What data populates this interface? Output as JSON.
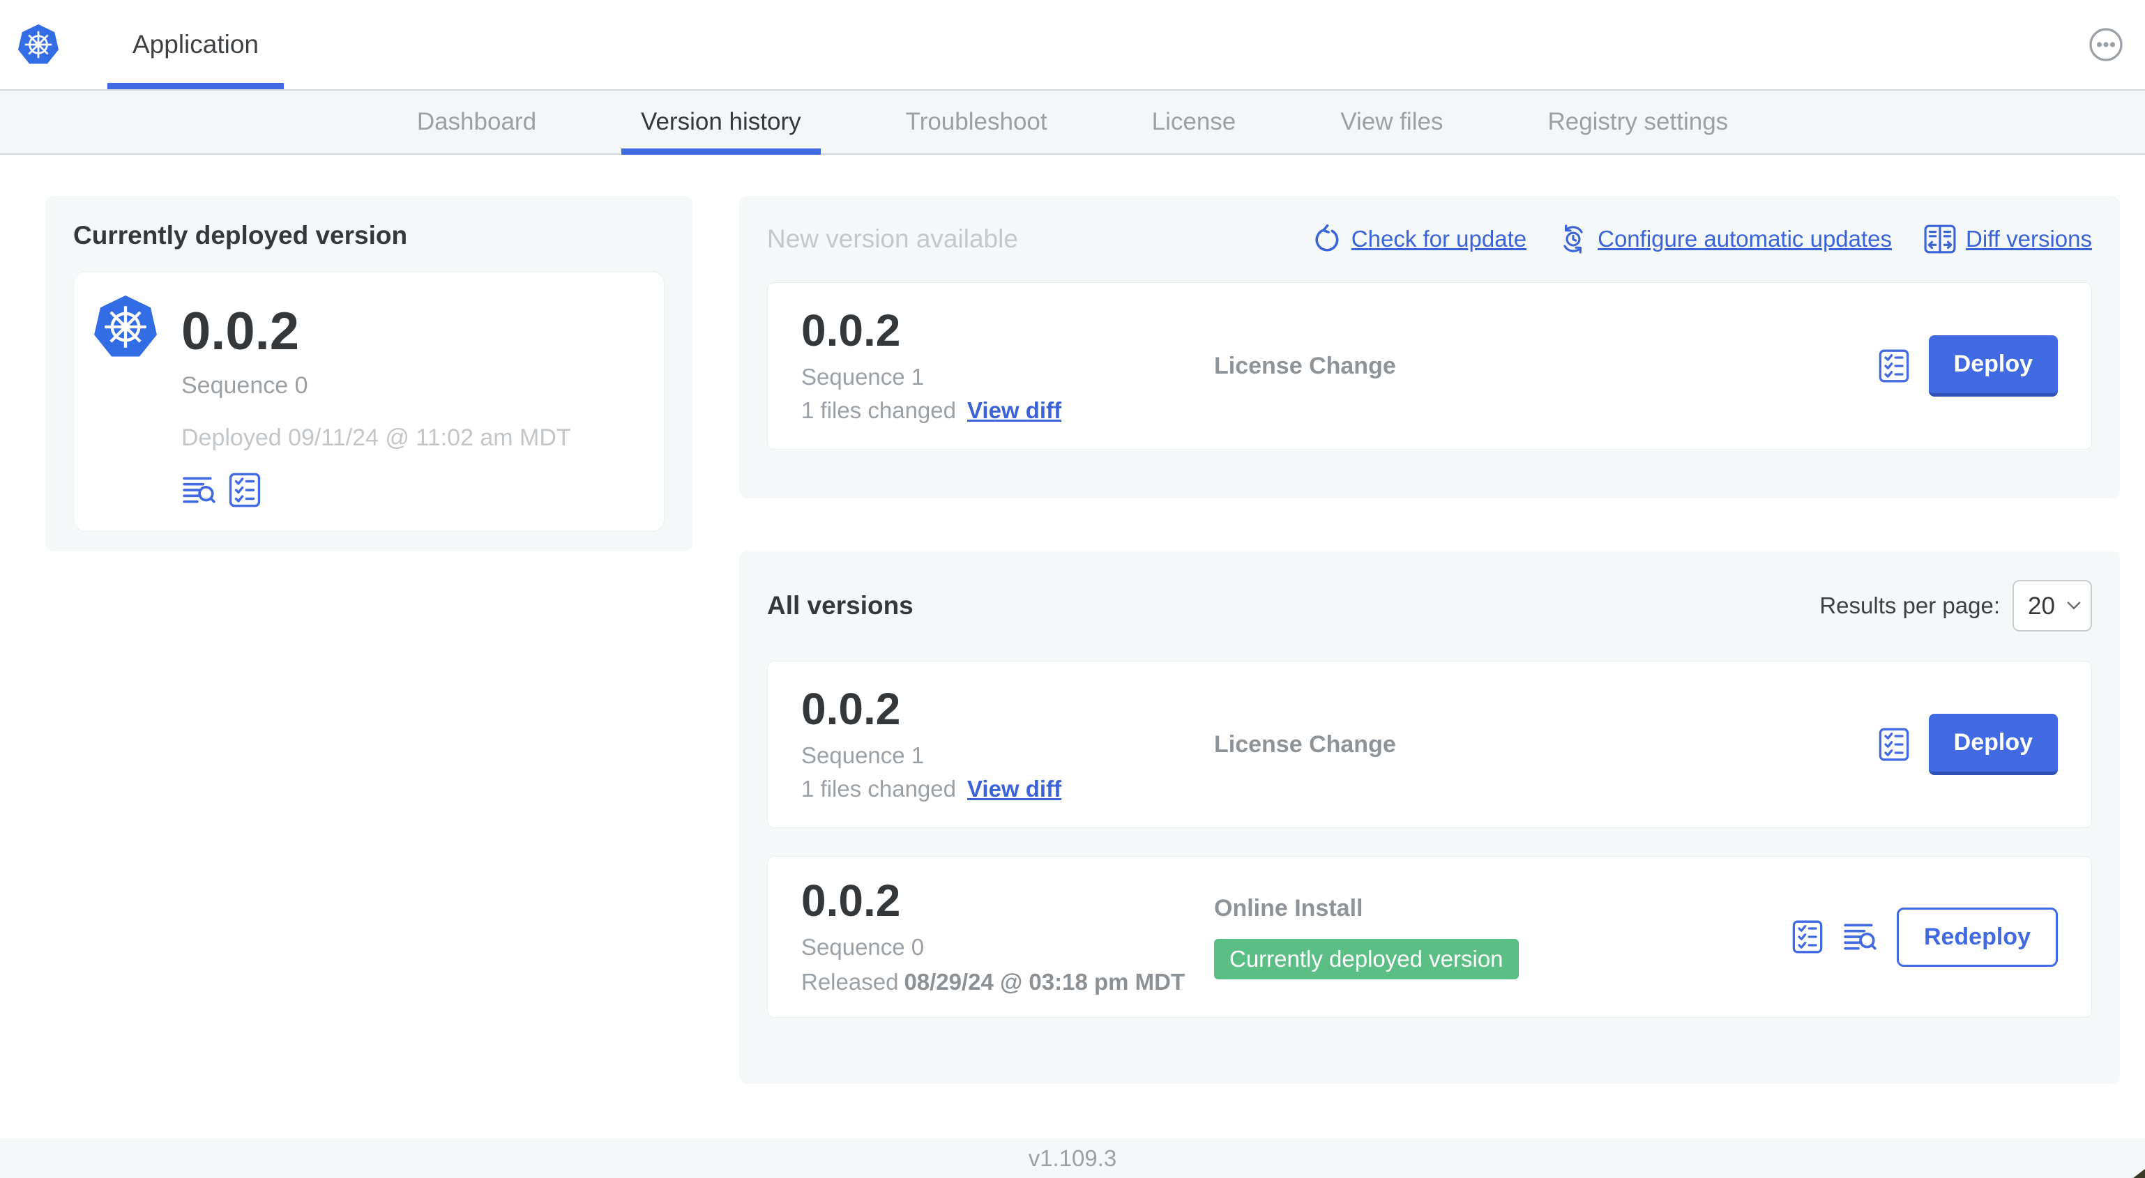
{
  "colors": {
    "accent_blue": "#4169e1",
    "link_blue": "#3b63d8",
    "badge_green": "#5abe85",
    "kubernetes_blue": "#326de6",
    "section_bg": "#f5f8f9"
  },
  "header": {
    "app_tab_label": "Application",
    "more_menu_icon": "ellipsis-in-circle"
  },
  "nav_tabs": [
    {
      "label": "Dashboard",
      "active": false
    },
    {
      "label": "Version history",
      "active": true
    },
    {
      "label": "Troubleshoot",
      "active": false
    },
    {
      "label": "License",
      "active": false
    },
    {
      "label": "View files",
      "active": false
    },
    {
      "label": "Registry settings",
      "active": false
    }
  ],
  "currently_deployed": {
    "title": "Currently deployed version",
    "version": "0.0.2",
    "sequence": "Sequence 0",
    "deployed_timestamp": "Deployed 09/11/24 @ 11:02 am MDT",
    "icons": [
      "view-logs-icon",
      "preflight-checks-icon"
    ]
  },
  "new_version": {
    "title": "New version available",
    "actions": {
      "check_for_update": "Check for update",
      "configure_automatic_updates": "Configure automatic updates",
      "diff_versions": "Diff versions"
    },
    "row": {
      "version": "0.0.2",
      "sequence": "Sequence 1",
      "files_changed": "1 files changed",
      "view_diff_label": "View diff",
      "source": "License Change",
      "deploy_label": "Deploy"
    }
  },
  "all_versions": {
    "title": "All versions",
    "results_per_page_label": "Results per page:",
    "results_per_page_value": "20",
    "rows": [
      {
        "version": "0.0.2",
        "sequence": "Sequence 1",
        "files_changed": "1 files changed",
        "view_diff_label": "View diff",
        "source": "License Change",
        "deploy_label": "Deploy"
      },
      {
        "version": "0.0.2",
        "sequence": "Sequence 0",
        "released_prefix": "Released",
        "released_timestamp": "08/29/24 @ 03:18 pm MDT",
        "source": "Online Install",
        "badge": "Currently deployed version",
        "redeploy_label": "Redeploy"
      }
    ]
  },
  "footer": {
    "app_manager_version": "v1.109.3"
  }
}
